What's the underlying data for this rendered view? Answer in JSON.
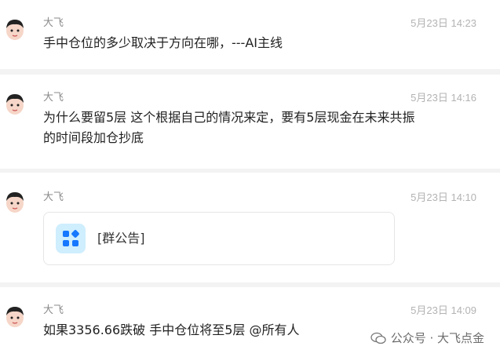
{
  "messages": [
    {
      "sender": "大飞",
      "time": "5月23日 14:23",
      "text": "手中仓位的多少取决于方向在哪，---AI主线"
    },
    {
      "sender": "大飞",
      "time": "5月23日 14:16",
      "text_line1": "为什么要留5层 这个根据自己的情况来定，要有5层现金在未来共振",
      "text_line2": "的时间段加仓抄底"
    },
    {
      "sender": "大飞",
      "time": "5月23日 14:10",
      "card_label": "[群公告]"
    },
    {
      "sender": "大飞",
      "time": "5月23日 14:09",
      "text": "如果3356.66跌破 手中仓位将至5层 @所有人"
    }
  ],
  "watermark": {
    "label": "公众号 · 大飞点金"
  }
}
